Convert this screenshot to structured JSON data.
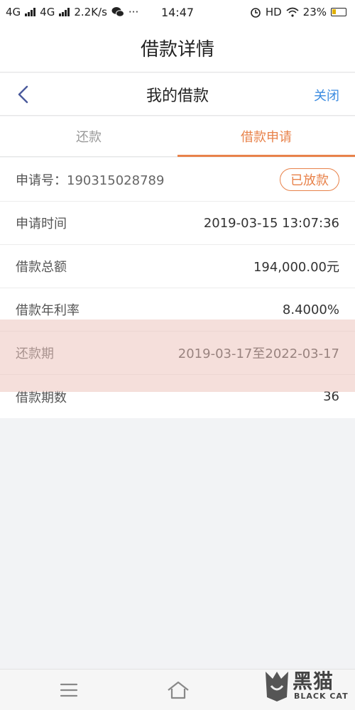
{
  "status_bar": {
    "net1": "4G",
    "net2": "4G",
    "speed": "2.2K/s",
    "more": "···",
    "time": "14:47",
    "hd": "HD",
    "battery": "23%"
  },
  "page": {
    "title": "借款详情"
  },
  "nav": {
    "title": "我的借款",
    "close": "关闭"
  },
  "tabs": [
    {
      "label": "还款",
      "active": false
    },
    {
      "label": "借款申请",
      "active": true
    }
  ],
  "detail": {
    "app_no_label": "申请号：",
    "app_no": "190315028789",
    "status_badge": "已放款",
    "rows": [
      {
        "label": "申请时间",
        "value": "2019-03-15 13:07:36"
      },
      {
        "label": "借款总额",
        "value": "194,000.00元"
      },
      {
        "label": "借款年利率",
        "value": "8.4000%"
      },
      {
        "label": "还款期",
        "value": "2019-03-17至2022-03-17"
      },
      {
        "label": "借款期数",
        "value": "36"
      }
    ]
  },
  "watermark": {
    "cn": "黑猫",
    "en": "BLACK CAT"
  },
  "colors": {
    "accent": "#e8824a",
    "link": "#3b8be0",
    "overlay": "#ecc4be"
  }
}
